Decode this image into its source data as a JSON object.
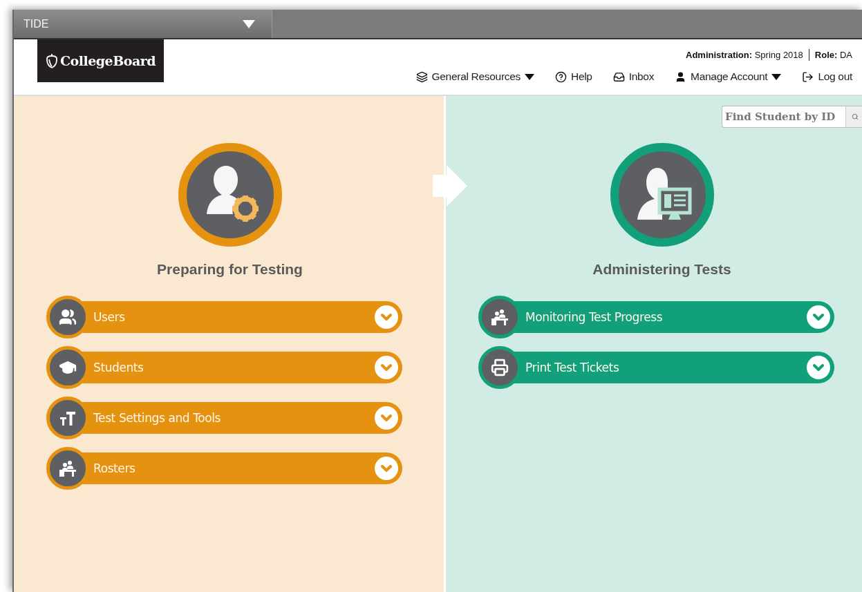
{
  "app_bar": {
    "title": "TIDE"
  },
  "header": {
    "logo": "CollegeBoard",
    "administration_label": "Administration:",
    "administration_value": "Spring 2018",
    "role_label": "Role:",
    "role_value": "DA",
    "nav": [
      {
        "kind": "resources",
        "label": "General Resources",
        "has_menu": true
      },
      {
        "kind": "help",
        "label": "Help",
        "has_menu": false
      },
      {
        "kind": "inbox",
        "label": "Inbox",
        "has_menu": false
      },
      {
        "kind": "account",
        "label": "Manage Account",
        "has_menu": true
      },
      {
        "kind": "logout",
        "label": "Log out",
        "has_menu": false
      }
    ]
  },
  "search": {
    "placeholder": "Find Student by ID"
  },
  "sections": [
    {
      "kind": "prepare",
      "title": "Preparing for Testing",
      "color": "#e4920f",
      "items": [
        {
          "kind": "users",
          "label": "Users",
          "expanded": false
        },
        {
          "kind": "students",
          "label": "Students",
          "expanded": false
        },
        {
          "kind": "settings",
          "label": "Test Settings and Tools",
          "expanded": false
        },
        {
          "kind": "rosters",
          "label": "Rosters",
          "expanded": false
        }
      ]
    },
    {
      "kind": "administer",
      "title": "Administering Tests",
      "color": "#12a07a",
      "items": [
        {
          "kind": "rosters",
          "label": "Monitoring Test Progress",
          "expanded": false
        },
        {
          "kind": "print",
          "label": "Print Test Tickets",
          "expanded": false
        }
      ]
    }
  ]
}
